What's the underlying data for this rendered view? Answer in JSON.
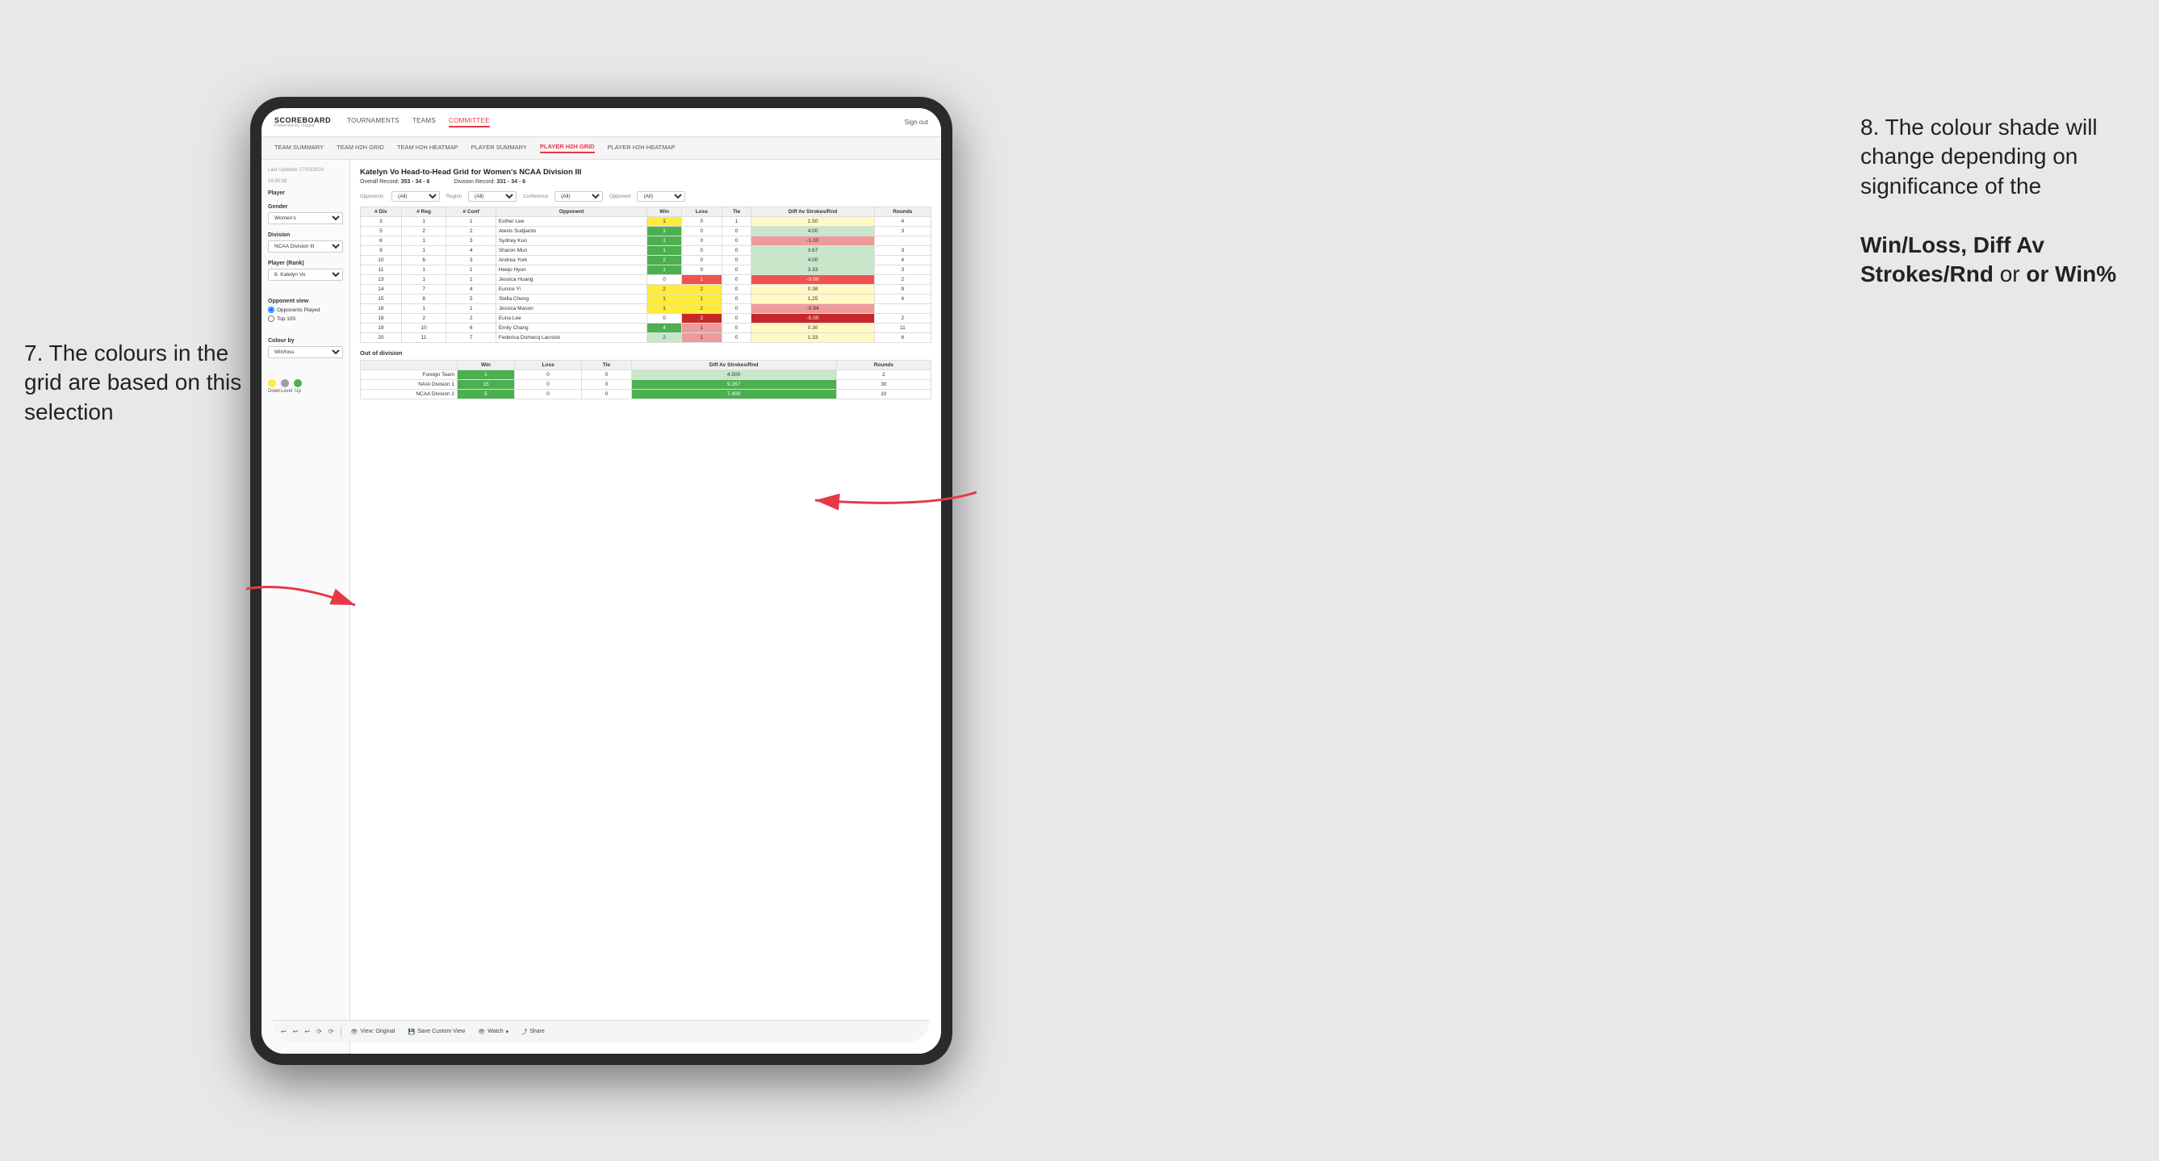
{
  "annotations": {
    "left_title": "7. The colours in the grid are based on this selection",
    "right_title": "8. The colour shade will change depending on significance of the",
    "right_bold1": "Win/Loss, Diff Av Strokes/Rnd",
    "right_bold2": "or Win%"
  },
  "nav": {
    "logo": "SCOREBOARD",
    "logo_sub": "Powered by clippd",
    "links": [
      "TOURNAMENTS",
      "TEAMS",
      "COMMITTEE"
    ],
    "active_link": "COMMITTEE",
    "right_text": "Sign out"
  },
  "sub_nav": {
    "links": [
      "TEAM SUMMARY",
      "TEAM H2H GRID",
      "TEAM H2H HEATMAP",
      "PLAYER SUMMARY",
      "PLAYER H2H GRID",
      "PLAYER H2H HEATMAP"
    ],
    "active_link": "PLAYER H2H GRID"
  },
  "sidebar": {
    "timestamp_label": "Last Updated: 27/03/2024",
    "timestamp_value": "16:55:38",
    "player_label": "Player",
    "gender_label": "Gender",
    "gender_value": "Women's",
    "division_label": "Division",
    "division_value": "NCAA Division III",
    "player_rank_label": "Player (Rank)",
    "player_rank_value": "8. Katelyn Vo",
    "opponent_view_label": "Opponent view",
    "opponent_played_label": "Opponents Played",
    "top100_label": "Top 100",
    "colour_by_label": "Colour by",
    "colour_by_value": "Win/loss",
    "legend": {
      "down_label": "Down",
      "level_label": "Level",
      "up_label": "Up"
    }
  },
  "content": {
    "title": "Katelyn Vo Head-to-Head Grid for Women's NCAA Division III",
    "overall_record_label": "Overall Record:",
    "overall_record_value": "353 - 34 - 6",
    "division_record_label": "Division Record:",
    "division_record_value": "331 - 34 - 6",
    "filters": {
      "opponents_label": "Opponents:",
      "opponents_value": "(All)",
      "region_label": "Region",
      "region_value": "(All)",
      "conference_label": "Conference",
      "conference_value": "(All)",
      "opponent_label": "Opponent",
      "opponent_value": "(All)"
    },
    "table_headers": [
      "# Div",
      "# Reg",
      "# Conf",
      "Opponent",
      "Win",
      "Loss",
      "Tie",
      "Diff Av Strokes/Rnd",
      "Rounds"
    ],
    "rows": [
      {
        "div": "3",
        "reg": "1",
        "conf": "1",
        "opponent": "Esther Lee",
        "win": "1",
        "loss": "0",
        "tie": "1",
        "diff": "1.50",
        "rounds": "4",
        "win_color": "yellow-bg",
        "loss_color": "",
        "diff_color": "yellow-light"
      },
      {
        "div": "5",
        "reg": "2",
        "conf": "2",
        "opponent": "Alexis Sudjianto",
        "win": "1",
        "loss": "0",
        "tie": "0",
        "diff": "4.00",
        "rounds": "3",
        "win_color": "green-strong",
        "loss_color": "",
        "diff_color": "green-light"
      },
      {
        "div": "6",
        "reg": "1",
        "conf": "3",
        "opponent": "Sydney Kuo",
        "win": "1",
        "loss": "0",
        "tie": "0",
        "diff": "-1.00",
        "rounds": "",
        "win_color": "green-strong",
        "loss_color": "",
        "diff_color": "loss-light"
      },
      {
        "div": "9",
        "reg": "1",
        "conf": "4",
        "opponent": "Sharon Mun",
        "win": "1",
        "loss": "0",
        "tie": "0",
        "diff": "3.67",
        "rounds": "3",
        "win_color": "green-strong",
        "loss_color": "",
        "diff_color": "green-light"
      },
      {
        "div": "10",
        "reg": "6",
        "conf": "3",
        "opponent": "Andrea York",
        "win": "2",
        "loss": "0",
        "tie": "0",
        "diff": "4.00",
        "rounds": "4",
        "win_color": "green-strong",
        "loss_color": "",
        "diff_color": "green-light"
      },
      {
        "div": "11",
        "reg": "1",
        "conf": "1",
        "opponent": "Heejo Hyun",
        "win": "1",
        "loss": "0",
        "tie": "0",
        "diff": "3.33",
        "rounds": "3",
        "win_color": "green-strong",
        "loss_color": "",
        "diff_color": "green-light"
      },
      {
        "div": "13",
        "reg": "1",
        "conf": "1",
        "opponent": "Jessica Huang",
        "win": "0",
        "loss": "1",
        "tie": "0",
        "diff": "-3.00",
        "rounds": "2",
        "win_color": "",
        "loss_color": "loss-medium",
        "diff_color": "loss-medium"
      },
      {
        "div": "14",
        "reg": "7",
        "conf": "4",
        "opponent": "Eunice Yi",
        "win": "2",
        "loss": "2",
        "tie": "0",
        "diff": "0.38",
        "rounds": "9",
        "win_color": "yellow-bg",
        "loss_color": "yellow-bg",
        "diff_color": "yellow-light"
      },
      {
        "div": "15",
        "reg": "8",
        "conf": "5",
        "opponent": "Stella Cheng",
        "win": "1",
        "loss": "1",
        "tie": "0",
        "diff": "1.25",
        "rounds": "4",
        "win_color": "yellow-bg",
        "loss_color": "yellow-bg",
        "diff_color": "yellow-light"
      },
      {
        "div": "16",
        "reg": "1",
        "conf": "1",
        "opponent": "Jessica Mason",
        "win": "1",
        "loss": "2",
        "tie": "0",
        "diff": "-0.94",
        "rounds": "",
        "win_color": "yellow-bg",
        "loss_color": "yellow-bg",
        "diff_color": "loss-light"
      },
      {
        "div": "18",
        "reg": "2",
        "conf": "2",
        "opponent": "Euna Lee",
        "win": "0",
        "loss": "2",
        "tie": "0",
        "diff": "-5.00",
        "rounds": "2",
        "win_color": "",
        "loss_color": "loss-strong",
        "diff_color": "loss-strong"
      },
      {
        "div": "19",
        "reg": "10",
        "conf": "6",
        "opponent": "Emily Chang",
        "win": "4",
        "loss": "1",
        "tie": "0",
        "diff": "0.30",
        "rounds": "11",
        "win_color": "green-strong",
        "loss_color": "loss-light",
        "diff_color": "yellow-light"
      },
      {
        "div": "20",
        "reg": "11",
        "conf": "7",
        "opponent": "Federica Domecq Lacroze",
        "win": "2",
        "loss": "1",
        "tie": "0",
        "diff": "1.33",
        "rounds": "6",
        "win_color": "green-light",
        "loss_color": "loss-light",
        "diff_color": "yellow-light"
      }
    ],
    "out_of_division_label": "Out of division",
    "out_of_division_rows": [
      {
        "name": "Foreign Team",
        "win": "1",
        "loss": "0",
        "tie": "0",
        "diff": "4.500",
        "rounds": "2",
        "win_color": "green-strong",
        "diff_color": "green-light"
      },
      {
        "name": "NAIA Division 1",
        "win": "15",
        "loss": "0",
        "tie": "0",
        "diff": "9.267",
        "rounds": "30",
        "win_color": "green-strong",
        "diff_color": "green-strong"
      },
      {
        "name": "NCAA Division 2",
        "win": "5",
        "loss": "0",
        "tie": "0",
        "diff": "7.400",
        "rounds": "10",
        "win_color": "green-strong",
        "diff_color": "green-strong"
      }
    ]
  },
  "toolbar": {
    "view_original": "View: Original",
    "save_custom": "Save Custom View",
    "watch": "Watch",
    "share": "Share"
  }
}
